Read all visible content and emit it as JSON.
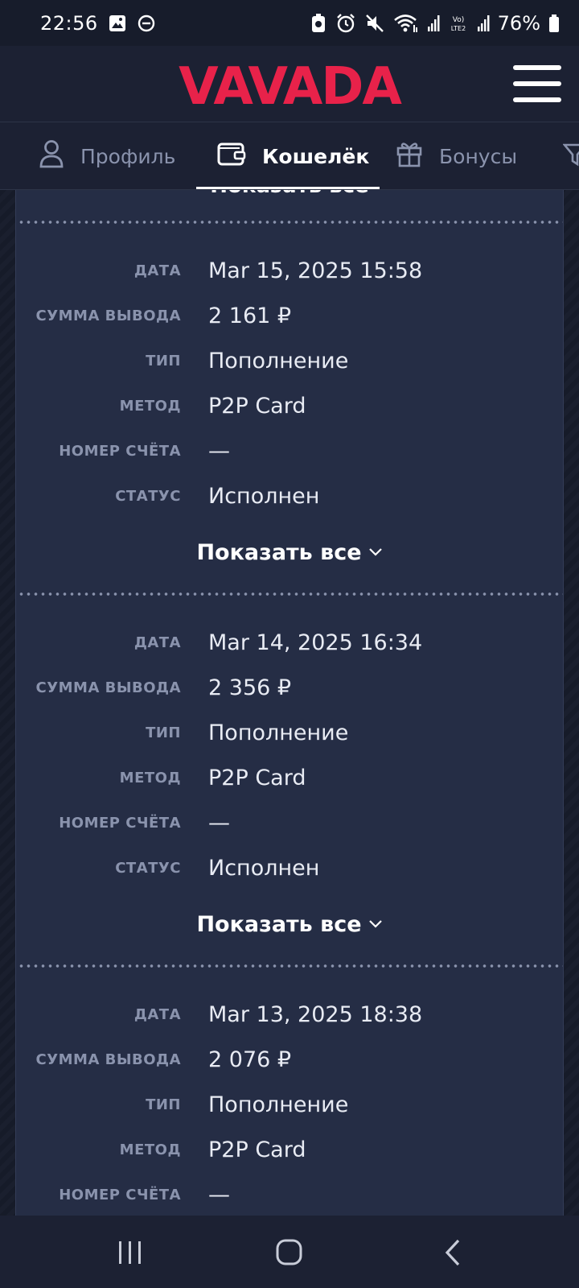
{
  "status_bar": {
    "time": "22:56",
    "battery": "76%",
    "icons": [
      "image-icon",
      "do-not-disturb-icon",
      "data-saver-icon",
      "alarm-icon",
      "mute-icon",
      "wifi-icon",
      "volte-icon",
      "signal-icon",
      "battery-icon"
    ]
  },
  "header": {
    "logo_text": "VAVADA",
    "logo_color": "#e8224a",
    "menu_icon": "hamburger-menu-icon"
  },
  "tabs": [
    {
      "label": "Профиль",
      "icon": "user-icon",
      "active": false
    },
    {
      "label": "Кошелёк",
      "icon": "wallet-icon",
      "active": true
    },
    {
      "label": "Бонусы",
      "icon": "gift-icon",
      "active": false
    }
  ],
  "history": {
    "show_all_label": "Показать все",
    "records": [
      {
        "fields": [
          {
            "label": "ДАТА",
            "value": "Mar 15, 2025 15:58"
          },
          {
            "label": "СУММА ВЫВОДА",
            "value": "2 161 ₽"
          },
          {
            "label": "ТИП",
            "value": "Пополнение"
          },
          {
            "label": "МЕТОД",
            "value": "P2P Card"
          },
          {
            "label": "НОМЕР СЧЁТА",
            "value": "—"
          },
          {
            "label": "СТАТУС",
            "value": "Исполнен"
          }
        ]
      },
      {
        "fields": [
          {
            "label": "ДАТА",
            "value": "Mar 14, 2025 16:34"
          },
          {
            "label": "СУММА ВЫВОДА",
            "value": "2 356 ₽"
          },
          {
            "label": "ТИП",
            "value": "Пополнение"
          },
          {
            "label": "МЕТОД",
            "value": "P2P Card"
          },
          {
            "label": "НОМЕР СЧЁТА",
            "value": "—"
          },
          {
            "label": "СТАТУС",
            "value": "Исполнен"
          }
        ]
      },
      {
        "fields": [
          {
            "label": "ДАТА",
            "value": "Mar 13, 2025 18:38"
          },
          {
            "label": "СУММА ВЫВОДА",
            "value": "2 076 ₽"
          },
          {
            "label": "ТИП",
            "value": "Пополнение"
          },
          {
            "label": "МЕТОД",
            "value": "P2P Card"
          },
          {
            "label": "НОМЕР СЧЁТА",
            "value": "—"
          }
        ]
      }
    ]
  },
  "nav_bar": {
    "buttons": [
      "recent-apps-icon",
      "home-icon",
      "back-icon"
    ]
  }
}
